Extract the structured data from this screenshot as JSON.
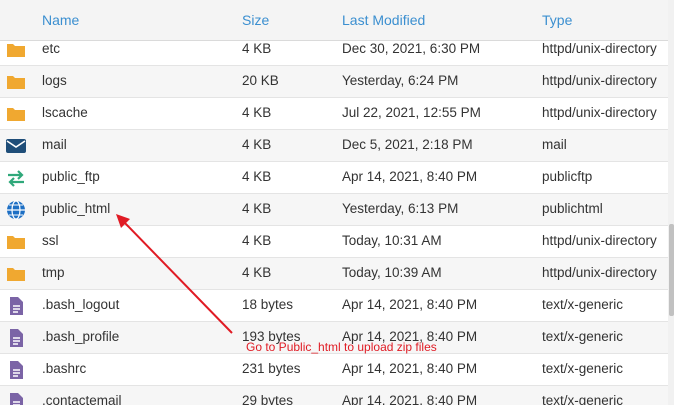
{
  "header": {
    "name": "Name",
    "size": "Size",
    "modified": "Last Modified",
    "type": "Type"
  },
  "files": [
    {
      "icon": "folder-icon",
      "name": "etc",
      "size": "4 KB",
      "modified": "Dec 30, 2021, 6:30 PM",
      "type": "httpd/unix-directory"
    },
    {
      "icon": "folder-icon",
      "name": "logs",
      "size": "20 KB",
      "modified": "Yesterday, 6:24 PM",
      "type": "httpd/unix-directory"
    },
    {
      "icon": "folder-icon",
      "name": "lscache",
      "size": "4 KB",
      "modified": "Jul 22, 2021, 12:55 PM",
      "type": "httpd/unix-directory"
    },
    {
      "icon": "mail-icon",
      "name": "mail",
      "size": "4 KB",
      "modified": "Dec 5, 2021, 2:18 PM",
      "type": "mail"
    },
    {
      "icon": "transfer-icon",
      "name": "public_ftp",
      "size": "4 KB",
      "modified": "Apr 14, 2021, 8:40 PM",
      "type": "publicftp"
    },
    {
      "icon": "globe-icon",
      "name": "public_html",
      "size": "4 KB",
      "modified": "Yesterday, 6:13 PM",
      "type": "publichtml"
    },
    {
      "icon": "folder-icon",
      "name": "ssl",
      "size": "4 KB",
      "modified": "Today, 10:31 AM",
      "type": "httpd/unix-directory"
    },
    {
      "icon": "folder-icon",
      "name": "tmp",
      "size": "4 KB",
      "modified": "Today, 10:39 AM",
      "type": "httpd/unix-directory"
    },
    {
      "icon": "file-icon",
      "name": ".bash_logout",
      "size": "18 bytes",
      "modified": "Apr 14, 2021, 8:40 PM",
      "type": "text/x-generic"
    },
    {
      "icon": "file-icon",
      "name": ".bash_profile",
      "size": "193 bytes",
      "modified": "Apr 14, 2021, 8:40 PM",
      "type": "text/x-generic"
    },
    {
      "icon": "file-icon",
      "name": ".bashrc",
      "size": "231 bytes",
      "modified": "Apr 14, 2021, 8:40 PM",
      "type": "text/x-generic"
    },
    {
      "icon": "file-icon",
      "name": ".contactemail",
      "size": "29 bytes",
      "modified": "Apr 14, 2021, 8:40 PM",
      "type": "text/x-generic"
    }
  ],
  "annotation": {
    "text": "Go to Public_html to upload zip files",
    "color": "#e01b24"
  },
  "colors": {
    "header_text": "#3b8fd0",
    "folder": "#f0a830",
    "mail": "#1f4e79",
    "transfer": "#2fa87a",
    "globe": "#1d6fc4",
    "file": "#7b64a6"
  }
}
